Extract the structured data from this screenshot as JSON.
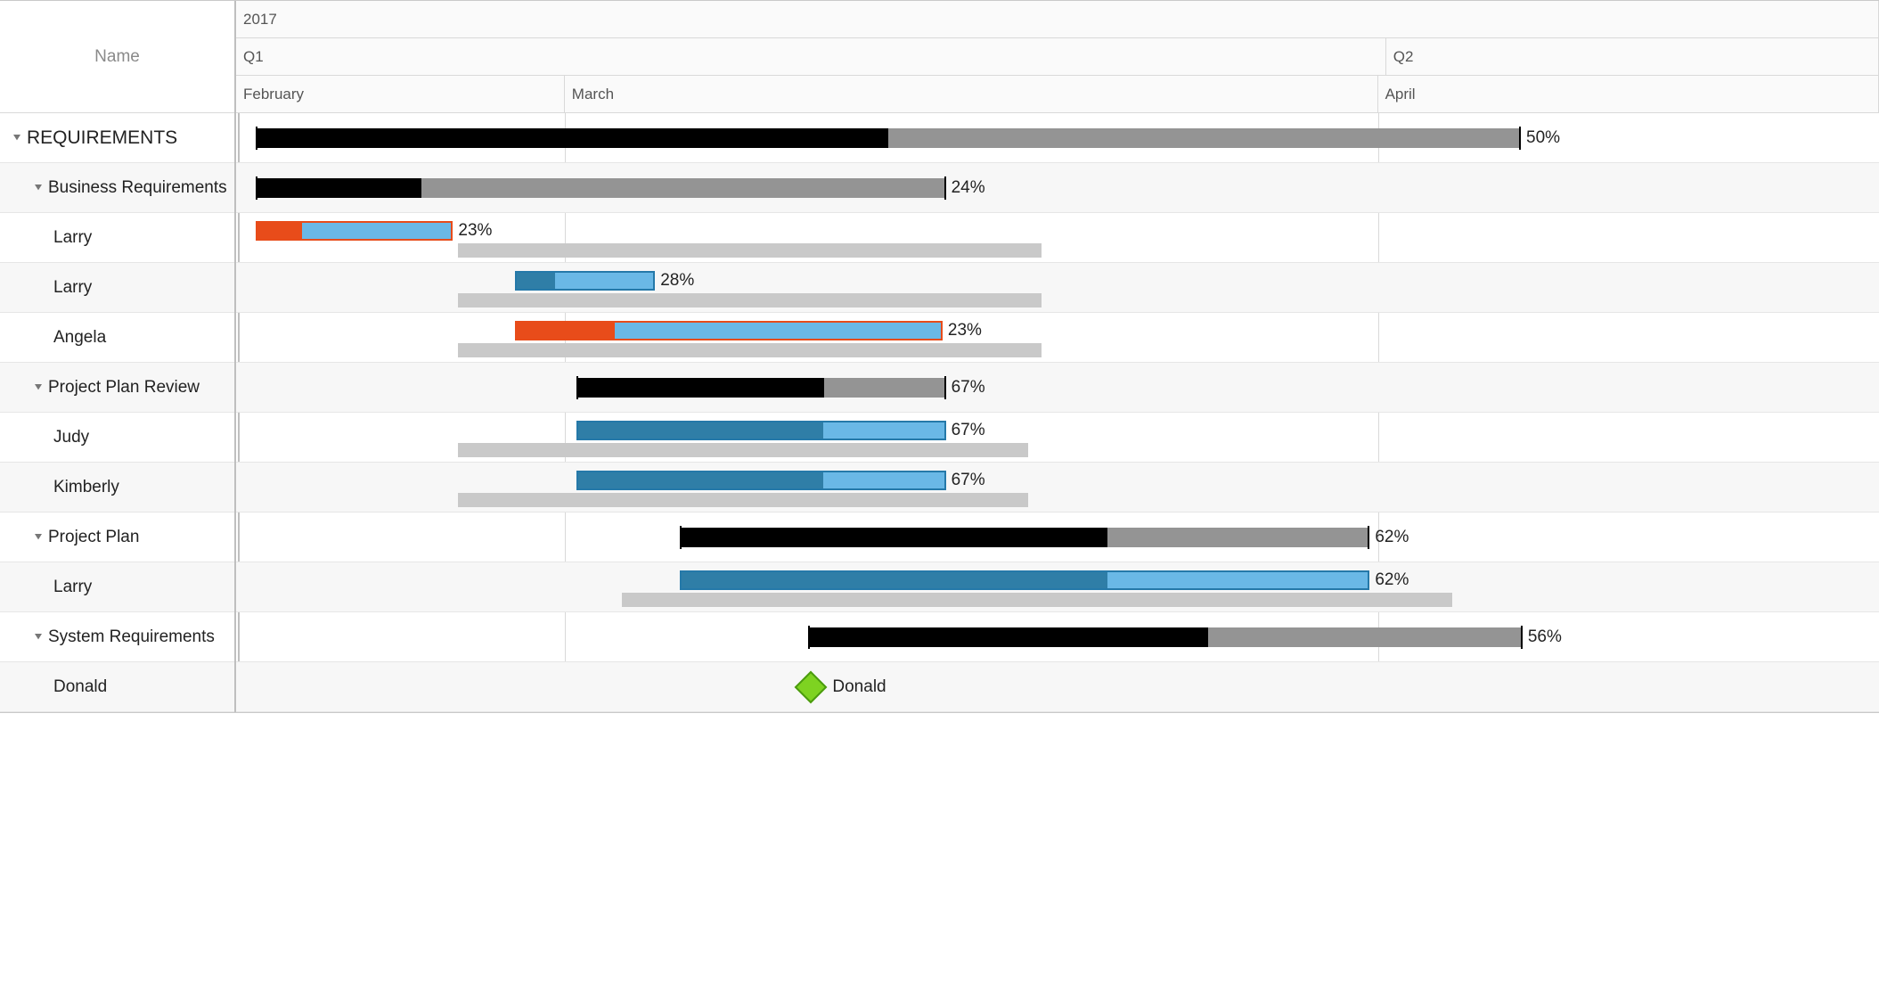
{
  "header": {
    "name_col": "Name",
    "year": "2017",
    "quarters": [
      {
        "label": "Q1",
        "left_pct": 0,
        "width_pct": 70
      },
      {
        "label": "Q2",
        "left_pct": 70,
        "width_pct": 30
      }
    ],
    "months": [
      {
        "label": "February",
        "left_pct": 0,
        "width_pct": 20
      },
      {
        "label": "March",
        "left_pct": 20,
        "width_pct": 49.5
      },
      {
        "label": "April",
        "left_pct": 69.5,
        "width_pct": 30.5
      }
    ]
  },
  "gridlines_pct": [
    20,
    69.5
  ],
  "rows": [
    {
      "id": "requirements",
      "label": "REQUIREMENTS",
      "indent": 0,
      "expandable": true,
      "type": "summary",
      "bar": {
        "left_pct": 1.2,
        "width_pct": 77,
        "progress_pct": 50
      },
      "pct_label": "50%"
    },
    {
      "id": "business-req",
      "label": "Business Requirements",
      "indent": 1,
      "expandable": true,
      "type": "summary",
      "bar": {
        "left_pct": 1.2,
        "width_pct": 42,
        "progress_pct": 24
      },
      "pct_label": "24%"
    },
    {
      "id": "larry-1",
      "label": "Larry",
      "indent": 2,
      "type": "task",
      "late": true,
      "bar": {
        "left_pct": 1.2,
        "width_pct": 12,
        "progress_pct": 23
      },
      "baseline": {
        "left_pct": 13.5,
        "width_pct": 35.5
      },
      "pct_label": "23%"
    },
    {
      "id": "larry-2",
      "label": "Larry",
      "indent": 2,
      "type": "task",
      "bar": {
        "left_pct": 17,
        "width_pct": 8.5,
        "progress_pct": 28
      },
      "baseline": {
        "left_pct": 13.5,
        "width_pct": 35.5
      },
      "pct_label": "28%"
    },
    {
      "id": "angela",
      "label": "Angela",
      "indent": 2,
      "type": "task",
      "late": true,
      "bar": {
        "left_pct": 17,
        "width_pct": 26,
        "progress_pct": 23
      },
      "baseline": {
        "left_pct": 13.5,
        "width_pct": 35.5
      },
      "pct_label": "23%"
    },
    {
      "id": "project-plan-review",
      "label": "Project Plan Review",
      "indent": 1,
      "expandable": true,
      "type": "summary",
      "bar": {
        "left_pct": 20.7,
        "width_pct": 22.5,
        "progress_pct": 67
      },
      "pct_label": "67%"
    },
    {
      "id": "judy",
      "label": "Judy",
      "indent": 2,
      "type": "task",
      "bar": {
        "left_pct": 20.7,
        "width_pct": 22.5,
        "progress_pct": 67
      },
      "baseline": {
        "left_pct": 13.5,
        "width_pct": 34.7
      },
      "pct_label": "67%"
    },
    {
      "id": "kimberly",
      "label": "Kimberly",
      "indent": 2,
      "type": "task",
      "bar": {
        "left_pct": 20.7,
        "width_pct": 22.5,
        "progress_pct": 67
      },
      "baseline": {
        "left_pct": 13.5,
        "width_pct": 34.7
      },
      "pct_label": "67%"
    },
    {
      "id": "project-plan",
      "label": "Project Plan",
      "indent": 1,
      "expandable": true,
      "type": "summary",
      "bar": {
        "left_pct": 27,
        "width_pct": 42,
        "progress_pct": 62
      },
      "pct_label": "62%"
    },
    {
      "id": "larry-3",
      "label": "Larry",
      "indent": 2,
      "type": "task",
      "bar": {
        "left_pct": 27,
        "width_pct": 42,
        "progress_pct": 62
      },
      "baseline": {
        "left_pct": 23.5,
        "width_pct": 50.5
      },
      "pct_label": "62%"
    },
    {
      "id": "system-req",
      "label": "System Requirements",
      "indent": 1,
      "expandable": true,
      "type": "summary",
      "bar": {
        "left_pct": 34.8,
        "width_pct": 43.5,
        "progress_pct": 56
      },
      "pct_label": "56%"
    },
    {
      "id": "donald",
      "label": "Donald",
      "indent": 2,
      "type": "milestone",
      "milestone": {
        "left_pct": 35,
        "label": "Donald"
      }
    }
  ],
  "chart_data": {
    "type": "table",
    "title": "Gantt chart — 2017 Q1/Q2",
    "time_axis": {
      "year": 2017,
      "quarters": [
        "Q1",
        "Q2"
      ],
      "months": [
        "February",
        "March",
        "April"
      ]
    },
    "tasks": [
      {
        "name": "REQUIREMENTS",
        "level": 0,
        "kind": "summary",
        "start": "2017-02-01",
        "end": "2017-04-02",
        "progress": 50
      },
      {
        "name": "Business Requirements",
        "level": 1,
        "kind": "summary",
        "start": "2017-02-01",
        "end": "2017-03-08",
        "progress": 24
      },
      {
        "name": "Larry",
        "level": 2,
        "kind": "task",
        "start": "2017-02-01",
        "end": "2017-02-10",
        "progress": 23,
        "baseline_start": "2017-02-11",
        "baseline_end": "2017-03-12",
        "status": "late"
      },
      {
        "name": "Larry",
        "level": 2,
        "kind": "task",
        "start": "2017-02-14",
        "end": "2017-02-21",
        "progress": 28,
        "baseline_start": "2017-02-11",
        "baseline_end": "2017-03-12"
      },
      {
        "name": "Angela",
        "level": 2,
        "kind": "task",
        "start": "2017-02-14",
        "end": "2017-03-08",
        "progress": 23,
        "baseline_start": "2017-02-11",
        "baseline_end": "2017-03-12",
        "status": "late"
      },
      {
        "name": "Project Plan Review",
        "level": 1,
        "kind": "summary",
        "start": "2017-02-17",
        "end": "2017-03-08",
        "progress": 67
      },
      {
        "name": "Judy",
        "level": 2,
        "kind": "task",
        "start": "2017-02-17",
        "end": "2017-03-08",
        "progress": 67,
        "baseline_start": "2017-02-11",
        "baseline_end": "2017-03-11"
      },
      {
        "name": "Kimberly",
        "level": 2,
        "kind": "task",
        "start": "2017-02-17",
        "end": "2017-03-08",
        "progress": 67,
        "baseline_start": "2017-02-11",
        "baseline_end": "2017-03-11"
      },
      {
        "name": "Project Plan",
        "level": 1,
        "kind": "summary",
        "start": "2017-02-22",
        "end": "2017-03-28",
        "progress": 62
      },
      {
        "name": "Larry",
        "level": 2,
        "kind": "task",
        "start": "2017-02-22",
        "end": "2017-03-28",
        "progress": 62,
        "baseline_start": "2017-02-19",
        "baseline_end": "2017-04-02"
      },
      {
        "name": "System Requirements",
        "level": 1,
        "kind": "summary",
        "start": "2017-02-28",
        "end": "2017-04-02",
        "progress": 56
      },
      {
        "name": "Donald",
        "level": 2,
        "kind": "milestone",
        "date": "2017-03-01"
      }
    ]
  }
}
